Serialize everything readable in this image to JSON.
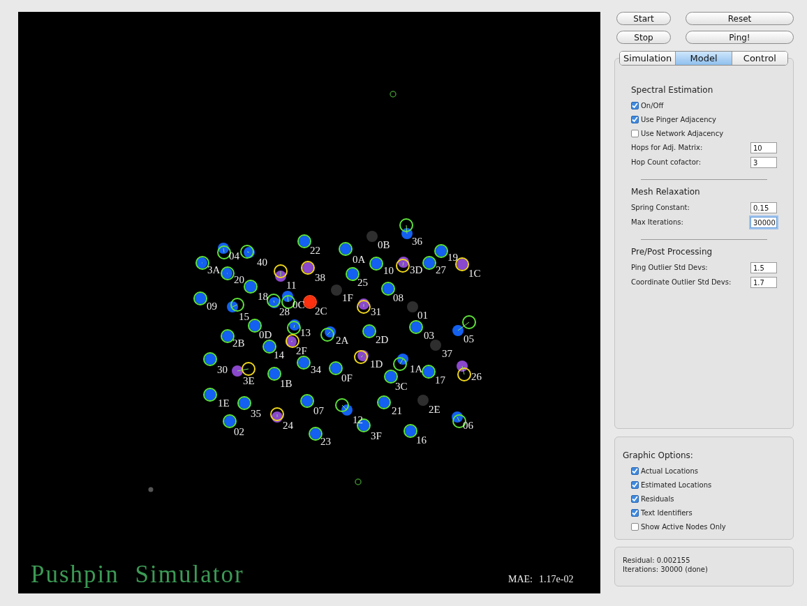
{
  "canvas": {
    "title": "Pushpin Simulator",
    "mae_label": "MAE:",
    "mae_value": "1.17e-02",
    "nodes": [
      {
        "label": "04",
        "kind": "tracked"
      },
      {
        "label": "40",
        "kind": "tracked"
      },
      {
        "label": "3A",
        "kind": "tracked"
      },
      {
        "label": "20",
        "kind": "tracked"
      },
      {
        "label": "22",
        "kind": "tracked"
      },
      {
        "label": "11",
        "kind": "outlier"
      },
      {
        "label": "38",
        "kind": "outlier"
      },
      {
        "label": "18",
        "kind": "tracked"
      },
      {
        "label": "09",
        "kind": "tracked"
      },
      {
        "label": "15",
        "kind": "tracked"
      },
      {
        "label": "28",
        "kind": "tracked"
      },
      {
        "label": "0C",
        "kind": "tracked"
      },
      {
        "label": "2C",
        "kind": "pinger"
      },
      {
        "label": "0B",
        "kind": "inactive"
      },
      {
        "label": "36",
        "kind": "tracked"
      },
      {
        "label": "0A",
        "kind": "tracked"
      },
      {
        "label": "10",
        "kind": "tracked"
      },
      {
        "label": "3D",
        "kind": "outlier"
      },
      {
        "label": "27",
        "kind": "tracked"
      },
      {
        "label": "19",
        "kind": "tracked"
      },
      {
        "label": "1C",
        "kind": "outlier"
      },
      {
        "label": "25",
        "kind": "tracked"
      },
      {
        "label": "1F",
        "kind": "inactive"
      },
      {
        "label": "08",
        "kind": "tracked"
      },
      {
        "label": "31",
        "kind": "outlier"
      },
      {
        "label": "01",
        "kind": "inactive"
      },
      {
        "label": "03",
        "kind": "tracked"
      },
      {
        "label": "05",
        "kind": "tracked"
      },
      {
        "label": "37",
        "kind": "inactive"
      },
      {
        "label": "0D",
        "kind": "tracked"
      },
      {
        "label": "13",
        "kind": "tracked"
      },
      {
        "label": "2B",
        "kind": "tracked"
      },
      {
        "label": "2A",
        "kind": "tracked"
      },
      {
        "label": "2D",
        "kind": "tracked"
      },
      {
        "label": "2F",
        "kind": "outlier"
      },
      {
        "label": "14",
        "kind": "tracked"
      },
      {
        "label": "34",
        "kind": "tracked"
      },
      {
        "label": "1D",
        "kind": "outlier"
      },
      {
        "label": "1A",
        "kind": "tracked"
      },
      {
        "label": "17",
        "kind": "tracked"
      },
      {
        "label": "26",
        "kind": "outlier"
      },
      {
        "label": "30",
        "kind": "tracked"
      },
      {
        "label": "3E",
        "kind": "outlier"
      },
      {
        "label": "1B",
        "kind": "tracked"
      },
      {
        "label": "0F",
        "kind": "tracked"
      },
      {
        "label": "3C",
        "kind": "tracked"
      },
      {
        "label": "1E",
        "kind": "tracked"
      },
      {
        "label": "35",
        "kind": "tracked"
      },
      {
        "label": "07",
        "kind": "tracked"
      },
      {
        "label": "12",
        "kind": "tracked"
      },
      {
        "label": "21",
        "kind": "tracked"
      },
      {
        "label": "2E",
        "kind": "inactive"
      },
      {
        "label": "24",
        "kind": "outlier"
      },
      {
        "label": "02",
        "kind": "tracked"
      },
      {
        "label": "23",
        "kind": "tracked"
      },
      {
        "label": "3F",
        "kind": "tracked"
      },
      {
        "label": "16",
        "kind": "tracked"
      },
      {
        "label": "06",
        "kind": "tracked"
      }
    ]
  },
  "buttons": [
    {
      "label": "Start"
    },
    {
      "label": "Reset"
    },
    {
      "label": "Stop"
    },
    {
      "label": "Ping!"
    }
  ],
  "tabs": [
    {
      "label": "Simulation",
      "selected": false
    },
    {
      "label": "Model",
      "selected": true
    },
    {
      "label": "Control",
      "selected": false
    }
  ],
  "model_sections": [
    {
      "title": "Spectral Estimation",
      "rows": [
        {
          "kind": "checkbox",
          "label": "On/Off",
          "checked": true
        },
        {
          "kind": "checkbox",
          "label": "Use Pinger Adjacency",
          "checked": true
        },
        {
          "kind": "checkbox",
          "label": "Use Network Adjacency",
          "checked": false
        },
        {
          "kind": "field",
          "label": "Hops for Adj. Matrix:",
          "value": "10",
          "focused": false
        },
        {
          "kind": "field",
          "label": "Hop Count cofactor:",
          "value": "3",
          "focused": false
        }
      ]
    },
    {
      "title": "Mesh Relaxation",
      "rows": [
        {
          "kind": "field",
          "label": "Spring Constant:",
          "value": "0.15",
          "focused": false
        },
        {
          "kind": "field",
          "label": "Max Iterations:",
          "value": "30000",
          "focused": true
        }
      ]
    },
    {
      "title": "Pre/Post Processing",
      "rows": [
        {
          "kind": "field",
          "label": "Ping Outlier Std Devs:",
          "value": "1.5",
          "focused": false
        },
        {
          "kind": "field",
          "label": "Coordinate Outlier Std Devs:",
          "value": "1.7",
          "focused": false
        }
      ]
    }
  ],
  "graphic_options": {
    "title": "Graphic Options:",
    "options": [
      {
        "label": "Actual Locations",
        "checked": true
      },
      {
        "label": "Estimated Locations",
        "checked": true
      },
      {
        "label": "Residuals",
        "checked": true
      },
      {
        "label": "Text Identifiers",
        "checked": true
      },
      {
        "label": "Show Active Nodes Only",
        "checked": false
      }
    ]
  },
  "status": [
    "Residual: 0.002155",
    "Iterations: 30000 (done)"
  ]
}
